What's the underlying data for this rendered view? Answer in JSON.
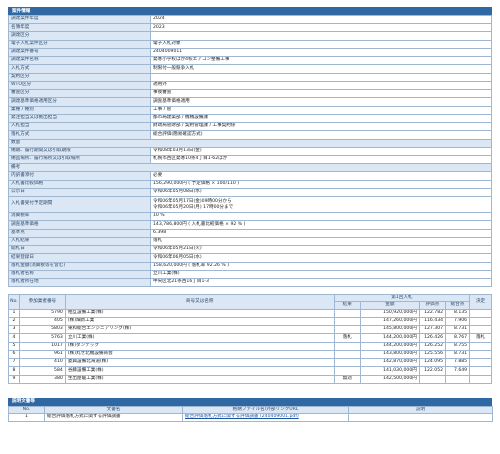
{
  "case_section": {
    "title": "案件情報",
    "rows": [
      {
        "label": "調達案件年度",
        "value": "2024"
      },
      {
        "label": "名簿年度",
        "value": "2023"
      },
      {
        "label": "調達区分",
        "value": ""
      },
      {
        "label": "電子入札案件区分",
        "value": "電子入札対象"
      },
      {
        "label": "調達案件番号",
        "value": "2404009011"
      },
      {
        "label": "調達案件名称",
        "value": "発寒小学校ほか4校エアコン整備工事"
      },
      {
        "label": "入札方式",
        "value": "制限付一般競争入札"
      },
      {
        "label": "契約区分",
        "value": ""
      },
      {
        "label": "WTO区分",
        "value": "適用外"
      },
      {
        "label": "審査区分",
        "value": "事後審査"
      },
      {
        "label": "調達基準価格適用区分",
        "value": "調査基準価格適用"
      },
      {
        "label": "業種 / 種別",
        "value": "工事 / 管"
      },
      {
        "label": "発注担当又は拠出担当",
        "value": "都市局建築部 / 機械設備課"
      },
      {
        "label": "入札担当",
        "value": "財政局管財部 / 契約管理課 / 工事契約係"
      },
      {
        "label": "落札方式",
        "value": "総合評価(簡易確認方式)"
      },
      {
        "section": "数量"
      },
      {
        "label": "納期、履行期間又は引取期限",
        "value": "令和08年03月13日(金)"
      },
      {
        "label": "納品場所、履行場所又は引取場所",
        "value": "札幌市西区発寒10条4丁目1-62ほか"
      },
      {
        "section": "備考"
      },
      {
        "label": "内訳書添付",
        "value": "必要"
      },
      {
        "label": "入札書比較価格",
        "value": "156,290,000円 ( 予定価格 × 100/110 )"
      },
      {
        "label": "公示日",
        "value": "令和06年05月08日(水)"
      },
      {
        "label": "入札書受付予定期間",
        "value": "令和06年05月17日(金)09時00分から\n令和06年05月20日(月) 17時00分まで",
        "tall": true
      },
      {
        "label": "消費税率",
        "value": "10 %"
      },
      {
        "label": "調査基準価格",
        "value": "143,786,800円 ( 入札書比較価格 × 92 % )"
      },
      {
        "label": "基準点",
        "value": "6.398"
      },
      {
        "label": "入札結果",
        "value": "落札"
      },
      {
        "label": "開札日",
        "value": "令和06年05月21日(火)"
      },
      {
        "label": "結果登録日",
        "value": "令和06年06月05日(水)"
      },
      {
        "label": "落札金額(消費税等を含む)",
        "value": "158,620,000円 ( 落札率 92.26 % )"
      },
      {
        "label": "落札者名称",
        "value": "立川工業(株)"
      },
      {
        "label": "落札者所在地",
        "value": "中央区北21条西16丁目1-3"
      }
    ]
  },
  "results": {
    "headers": {
      "no": "No.",
      "reg": "参加業者番号",
      "name": "商号又は名称",
      "group": "第1回入札",
      "result": "結果",
      "amount": "金額",
      "eval": "評価点",
      "total": "総合点",
      "decision": "決定"
    },
    "rows": [
      {
        "no": "1",
        "reg": "5790",
        "name": "相互設備工業(株)",
        "result": "",
        "amount": "150,920,000円",
        "eval": "122.782",
        "total": "8.135",
        "decision": ""
      },
      {
        "no": "2",
        "reg": "405",
        "name": "(株)畑新工業",
        "result": "",
        "amount": "147,260,000円",
        "eval": "116.434",
        "total": "7.906",
        "decision": ""
      },
      {
        "no": "3",
        "reg": "5803",
        "name": "東和総合エンジニアリング(株)",
        "result": "",
        "amount": "145,800,000円",
        "eval": "127.307",
        "total": "8.731",
        "decision": ""
      },
      {
        "no": "4",
        "reg": "5763",
        "name": "立川工業(株)",
        "result": "落札",
        "amount": "144,200,000円",
        "eval": "126.426",
        "total": "8.767",
        "decision": "落札"
      },
      {
        "no": "5",
        "reg": "1017",
        "name": "(株)ダンテック",
        "result": "",
        "amount": "144,200,000円",
        "eval": "126.252",
        "total": "8.755",
        "decision": ""
      },
      {
        "no": "6",
        "reg": "961",
        "name": "(株)丸せ北機設備商会",
        "result": "",
        "amount": "143,800,000円",
        "eval": "125.556",
        "total": "8.731",
        "decision": ""
      },
      {
        "no": "7",
        "reg": "410",
        "name": "菱興設備北海道(株)",
        "result": "",
        "amount": "142,870,000円",
        "eval": "124.095",
        "total": "7.885",
        "decision": ""
      },
      {
        "no": "8",
        "reg": "584",
        "name": "谷藤設備工業(株)",
        "result": "",
        "amount": "141,030,000円",
        "eval": "122.052",
        "total": "7.649",
        "decision": ""
      },
      {
        "no": "9",
        "reg": "380",
        "name": "生出屋暖工業(株)",
        "result": "無効",
        "amount": "142,500,000円",
        "eval": "",
        "total": "",
        "decision": ""
      }
    ]
  },
  "docs": {
    "title": "説明文書等",
    "headers": {
      "no": "No.",
      "name": "文書名",
      "file": "格納ファイル名/外部リンクURL",
      "desc": "説明"
    },
    "rows": [
      {
        "no": "1",
        "name": "総合評価落札方式に関する評価調書",
        "file": "総合評価落札方式に関する評価調書 (240409001.pdf)",
        "desc": ""
      }
    ]
  }
}
